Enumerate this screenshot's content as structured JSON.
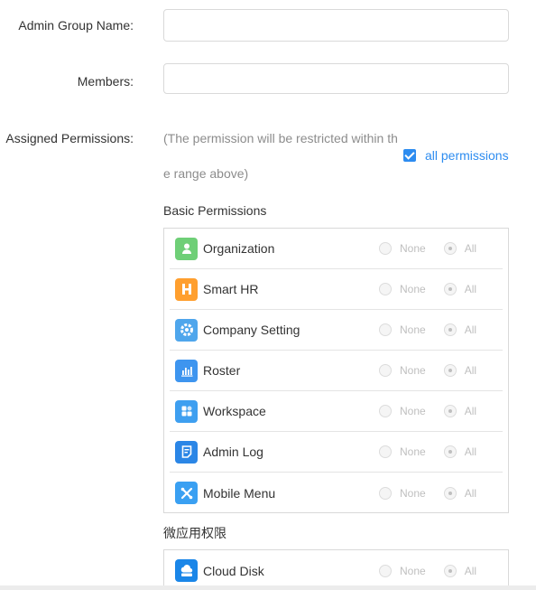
{
  "form": {
    "admin_group_name_label": "Admin Group Name:",
    "admin_group_name_value": "",
    "members_label": "Members:",
    "members_value": "",
    "assigned_permissions_label": "Assigned Permissions:",
    "permission_note_line1": "(The permission will be restricted within th",
    "permission_note_line2": "e range above)",
    "all_permissions_label": "all permissions",
    "all_permissions_checked": true
  },
  "basic_permissions": {
    "title": "Basic Permissions",
    "items": [
      {
        "name": "Organization",
        "icon": "organization-icon",
        "color": "#6fcf77",
        "selected": "All"
      },
      {
        "name": "Smart HR",
        "icon": "smart-hr-icon",
        "color": "#ff9f2e",
        "selected": "All"
      },
      {
        "name": "Company Setting",
        "icon": "company-setting-icon",
        "color": "#4fa6ec",
        "selected": "All"
      },
      {
        "name": "Roster",
        "icon": "roster-icon",
        "color": "#3e95ef",
        "selected": "All"
      },
      {
        "name": "Workspace",
        "icon": "workspace-icon",
        "color": "#3e9ff0",
        "selected": "All"
      },
      {
        "name": "Admin Log",
        "icon": "admin-log-icon",
        "color": "#2b86e6",
        "selected": "All"
      },
      {
        "name": "Mobile Menu",
        "icon": "mobile-menu-icon",
        "color": "#3aa0f2",
        "selected": "All"
      }
    ]
  },
  "micro_app_permissions": {
    "title": "微应用权限",
    "items": [
      {
        "name": "Cloud Disk",
        "icon": "cloud-disk-icon",
        "color": "#1a86e8",
        "selected": "All"
      }
    ]
  },
  "radio_options": {
    "none": "None",
    "all": "All"
  },
  "colors": {
    "accent": "#2d8cf0",
    "border": "#d9d9d9"
  }
}
